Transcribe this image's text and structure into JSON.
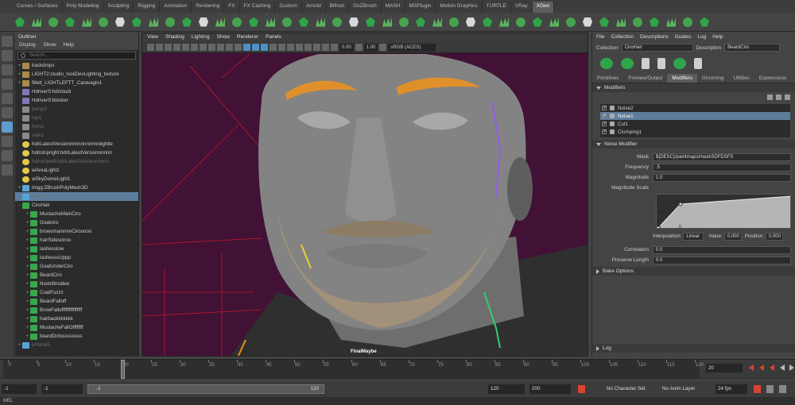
{
  "shelf_tabs": [
    "Curves / Surfaces",
    "Poly Modeling",
    "Sculpting",
    "Rigging",
    "Animation",
    "Rendering",
    "FX",
    "FX Caching",
    "Custom",
    "Arnold",
    "Bifrost",
    "GoZBrush",
    "MASH",
    "MSPlugin",
    "Motion Graphics",
    "TURTLE",
    "VRay",
    "XGen"
  ],
  "active_shelf": "XGen",
  "outliner": {
    "title": "Outliner",
    "menu": [
      "Display",
      "Show",
      "Help"
    ],
    "search_placeholder": "Search...",
    "items": [
      {
        "label": "backdrops",
        "icon": "folder-icon",
        "expand": "+",
        "dim": false,
        "selected": false,
        "indent": 0
      },
      {
        "label": "LIGHT2:studio_lookDevLighting_texture",
        "icon": "folder-icon",
        "expand": "+",
        "dim": false,
        "selected": false,
        "indent": 0
      },
      {
        "label": "fillett_LIGHTLEFTT_Caravagio1",
        "icon": "folder-icon",
        "expand": "+",
        "dim": false,
        "selected": false,
        "indent": 0
      },
      {
        "label": "HdriverS:hdristudi",
        "icon": "shader-icon",
        "expand": "",
        "dim": false,
        "selected": false,
        "indent": 0
      },
      {
        "label": "HdriverS:blocker",
        "icon": "shader-icon",
        "expand": "",
        "dim": false,
        "selected": false,
        "indent": 0
      },
      {
        "label": "persp2",
        "icon": "camera-icon",
        "expand": "",
        "dim": true,
        "selected": false,
        "indent": 0
      },
      {
        "label": "top1",
        "icon": "camera-icon",
        "expand": "",
        "dim": true,
        "selected": false,
        "indent": 0
      },
      {
        "label": "front1",
        "icon": "camera-icon",
        "expand": "",
        "dim": true,
        "selected": false,
        "indent": 0
      },
      {
        "label": "side1",
        "icon": "camera-icon",
        "expand": "",
        "dim": true,
        "selected": false,
        "indent": 0
      },
      {
        "label": "hdriLatestVersionnnnnnnnnnnnlightle",
        "icon": "light-icon",
        "expand": "",
        "dim": false,
        "selected": false,
        "indent": 0
      },
      {
        "label": "hdristripright:hdriLatestVersionnnnnn",
        "icon": "light-icon",
        "expand": "",
        "dim": false,
        "selected": false,
        "indent": 0
      },
      {
        "label": "hdristripleft:hdriLatestVersionnnnnn",
        "icon": "light-icon",
        "expand": "",
        "dim": true,
        "selected": false,
        "indent": 0
      },
      {
        "label": "aiAreaLight1",
        "icon": "light-icon",
        "expand": "",
        "dim": false,
        "selected": false,
        "indent": 0
      },
      {
        "label": "aiSkyDomeLight1",
        "icon": "light-icon",
        "expand": "",
        "dim": false,
        "selected": false,
        "indent": 0
      },
      {
        "label": "ringg:ZBrushPolyMesh3D",
        "icon": "mesh-icon",
        "expand": "+",
        "dim": false,
        "selected": false,
        "indent": 0
      },
      {
        "label": "head",
        "icon": "mesh-icon",
        "expand": "",
        "dim": true,
        "selected": true,
        "indent": 0
      },
      {
        "label": "CiroHair",
        "icon": "xgen-icon",
        "expand": "-",
        "dim": false,
        "selected": false,
        "indent": 0
      },
      {
        "label": "MustacheMainCiro",
        "icon": "xgen-icon",
        "expand": "+",
        "dim": false,
        "selected": false,
        "indent": 1
      },
      {
        "label": "Goatciro",
        "icon": "xgen-icon",
        "expand": "+",
        "dim": false,
        "selected": false,
        "indent": 1
      },
      {
        "label": "browsmainnnnCirooooo",
        "icon": "xgen-icon",
        "expand": "+",
        "dim": false,
        "selected": false,
        "indent": 1
      },
      {
        "label": "hairSidesciroo",
        "icon": "xgen-icon",
        "expand": "+",
        "dim": false,
        "selected": false,
        "indent": 1
      },
      {
        "label": "lashesslow",
        "icon": "xgen-icon",
        "expand": "+",
        "dim": false,
        "selected": false,
        "indent": 1
      },
      {
        "label": "lashesssUppp",
        "icon": "xgen-icon",
        "expand": "+",
        "dim": false,
        "selected": false,
        "indent": 1
      },
      {
        "label": "GoatUnderCiro",
        "icon": "xgen-icon",
        "expand": "+",
        "dim": false,
        "selected": false,
        "indent": 1
      },
      {
        "label": "BeardCiro",
        "icon": "xgen-icon",
        "expand": "+",
        "dim": false,
        "selected": false,
        "indent": 1
      },
      {
        "label": "Nostrillnsidee",
        "icon": "xgen-icon",
        "expand": "+",
        "dim": false,
        "selected": false,
        "indent": 1
      },
      {
        "label": "CoatFuzzz",
        "icon": "xgen-icon",
        "expand": "+",
        "dim": false,
        "selected": false,
        "indent": 1
      },
      {
        "label": "BeardFalloff",
        "icon": "xgen-icon",
        "expand": "+",
        "dim": false,
        "selected": false,
        "indent": 1
      },
      {
        "label": "BrowFalloffffffffffffffff",
        "icon": "xgen-icon",
        "expand": "+",
        "dim": false,
        "selected": false,
        "indent": 1
      },
      {
        "label": "hairbackkkkkkk",
        "icon": "xgen-icon",
        "expand": "+",
        "dim": false,
        "selected": false,
        "indent": 1
      },
      {
        "label": "MustacheFallOffffffff",
        "icon": "xgen-icon",
        "expand": "+",
        "dim": false,
        "selected": false,
        "indent": 1
      },
      {
        "label": "beardDotsssssssss",
        "icon": "xgen-icon",
        "expand": "+",
        "dim": false,
        "selected": false,
        "indent": 1
      },
      {
        "label": "pPlane5",
        "icon": "mesh-icon",
        "expand": "+",
        "dim": true,
        "selected": false,
        "indent": 0
      }
    ]
  },
  "viewport": {
    "menu": [
      "View",
      "Shading",
      "Lighting",
      "Show",
      "Renderer",
      "Panels"
    ],
    "exposure": "0.00",
    "gamma": "1.00",
    "colorspace": "sRGB (ACES)",
    "camera_label": "FinalMaybe",
    "background_color": "#411235"
  },
  "xgen": {
    "menu": [
      "File",
      "Collection",
      "Descriptions",
      "Guides",
      "Log",
      "Help"
    ],
    "collection_label": "Collection",
    "collection_value": "CiroHair",
    "description_label": "Description",
    "description_value": "BeardCiro",
    "tabs": [
      "Primitives",
      "Preview/Output",
      "Modifiers",
      "Grooming",
      "Utilities",
      "Expressions"
    ],
    "active_tab": "Modifiers",
    "modifiers_header": "Modifiers",
    "modifiers": [
      {
        "label": "Noise2",
        "checked": true,
        "selected": false
      },
      {
        "label": "Noise1",
        "checked": true,
        "selected": true
      },
      {
        "label": "Cut1",
        "checked": true,
        "selected": false
      },
      {
        "label": "Clumping1",
        "checked": true,
        "selected": false
      }
    ],
    "noise_header": "Noise Modifier",
    "mask_label": "Mask",
    "mask_value": "${DESC}/paintmaps/maskSDFDSFS",
    "frequency_label": "Frequency",
    "frequency_value": ".5",
    "magnitude_label": "Magnitude",
    "magnitude_value": "1.0",
    "magnitude_scale_label": "Magnitude Scale",
    "ramp_letter": "R",
    "ramp_tick": "0",
    "interpolation_label": "Interpolation:",
    "interpolation_value": "Linear",
    "value_label": "Value:",
    "value_value": "0.000",
    "position_label": "Position:",
    "position_value": "0.000",
    "correlation_label": "Correlation",
    "correlation_value": "0.0",
    "preserve_length_label": "Preserve Length",
    "preserve_length_value": "0.0",
    "bake_options": "Bake Options",
    "log_label": "Log"
  },
  "timeslider": {
    "ticks": [
      "0",
      "5",
      "10",
      "15",
      "20",
      "25",
      "30",
      "35",
      "40",
      "45",
      "50",
      "55",
      "60",
      "65",
      "70",
      "75",
      "80",
      "85",
      "90",
      "95",
      "100",
      "105",
      "110",
      "115",
      "120"
    ],
    "current_frame": "20",
    "cursor_fraction": 0.1667
  },
  "rangeslider": {
    "start": "-1",
    "anim_start": "-1",
    "range_start": "-1",
    "range_end": "120",
    "anim_end": "120",
    "end": "200",
    "character_set": "No Character Set",
    "anim_layer": "No Anim Layer",
    "fps": "24 fps"
  },
  "command_line": "MEL"
}
